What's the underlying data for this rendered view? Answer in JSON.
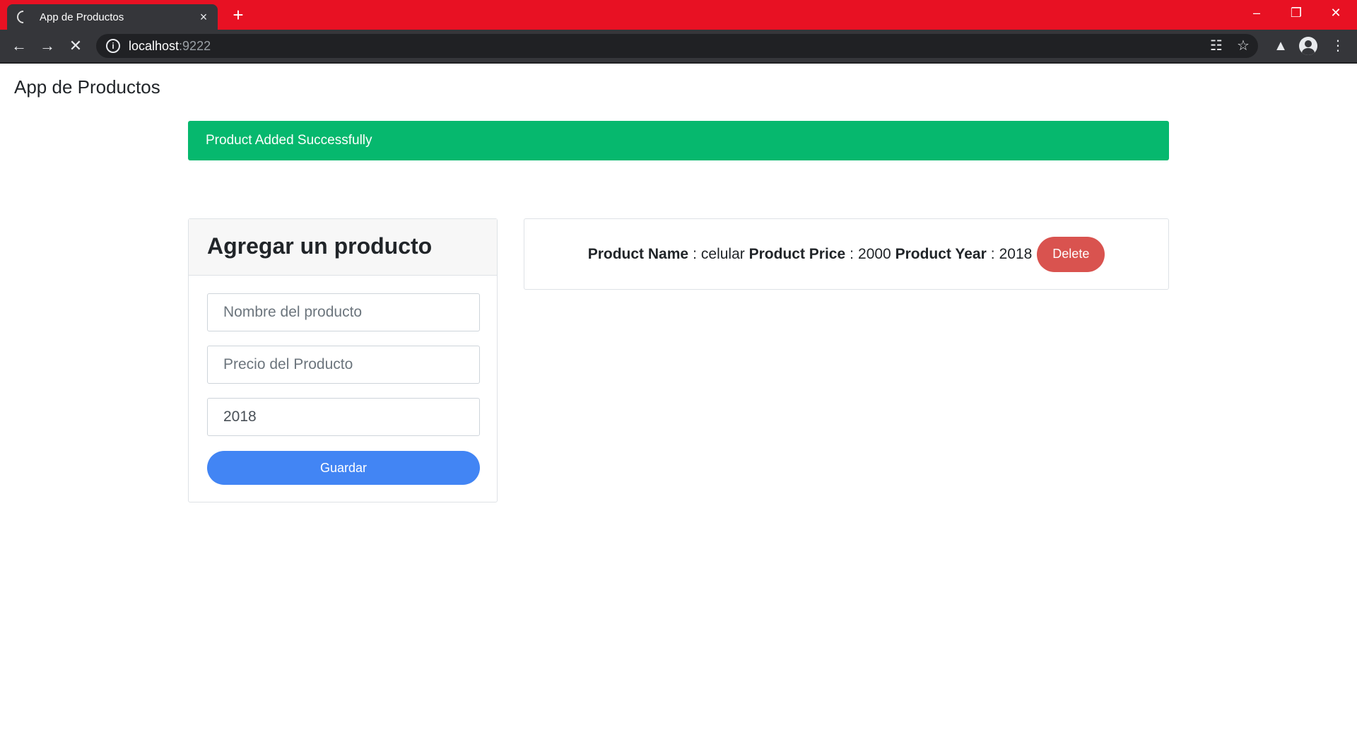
{
  "browser": {
    "tab_title": "App de Productos",
    "tab_close": "×",
    "new_tab": "+",
    "url_host": "localhost",
    "url_port": ":9222",
    "accent": "#e81123"
  },
  "navbar": {
    "brand": "App de Productos"
  },
  "alert": {
    "message": "Product Added Successfully",
    "color": "#06b86e"
  },
  "form": {
    "title": "Agregar un producto",
    "name_placeholder": "Nombre del producto",
    "name_value": "",
    "price_placeholder": "Precio del Producto",
    "price_value": "",
    "year_value": "2018",
    "save_label": "Guardar"
  },
  "products": {
    "items": [
      {
        "name_label": "Product Name",
        "name": "celular",
        "price_label": "Product Price",
        "price": "2000",
        "year_label": "Product Year",
        "year": "2018",
        "delete_label": "Delete"
      }
    ]
  }
}
